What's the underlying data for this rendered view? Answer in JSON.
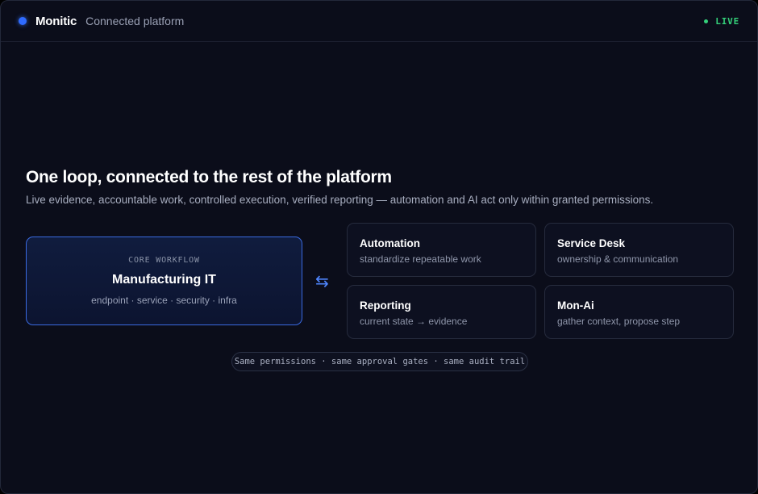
{
  "header": {
    "brand": "Monitic",
    "subtitle": "Connected platform",
    "status": "LIVE"
  },
  "hero": {
    "title": "One loop, connected to the rest of the platform",
    "subtitle": "Live evidence, accountable work, controlled execution, verified reporting — automation and AI act only within granted permissions."
  },
  "core": {
    "eyebrow": "CORE WORKFLOW",
    "title": "Manufacturing IT",
    "tags": "endpoint · service · security · infra"
  },
  "connector_glyph": "⇆",
  "modules": [
    {
      "title": "Automation",
      "desc": "standardize repeatable work"
    },
    {
      "title": "Service Desk",
      "desc": "ownership & communication"
    },
    {
      "title": "Reporting",
      "desc": "current state → evidence"
    },
    {
      "title": "Mon-Ai",
      "desc": "gather context, propose step"
    }
  ],
  "footer_pill": "Same permissions · same approval gates · same audit trail",
  "colors": {
    "background": "#0b0d1a",
    "accent": "#2f6bff",
    "live": "#34d07a"
  },
  "icons": {
    "brand": "brand-dot-icon",
    "status": "live-dot-icon",
    "connector": "bidirectional-arrows-icon"
  }
}
